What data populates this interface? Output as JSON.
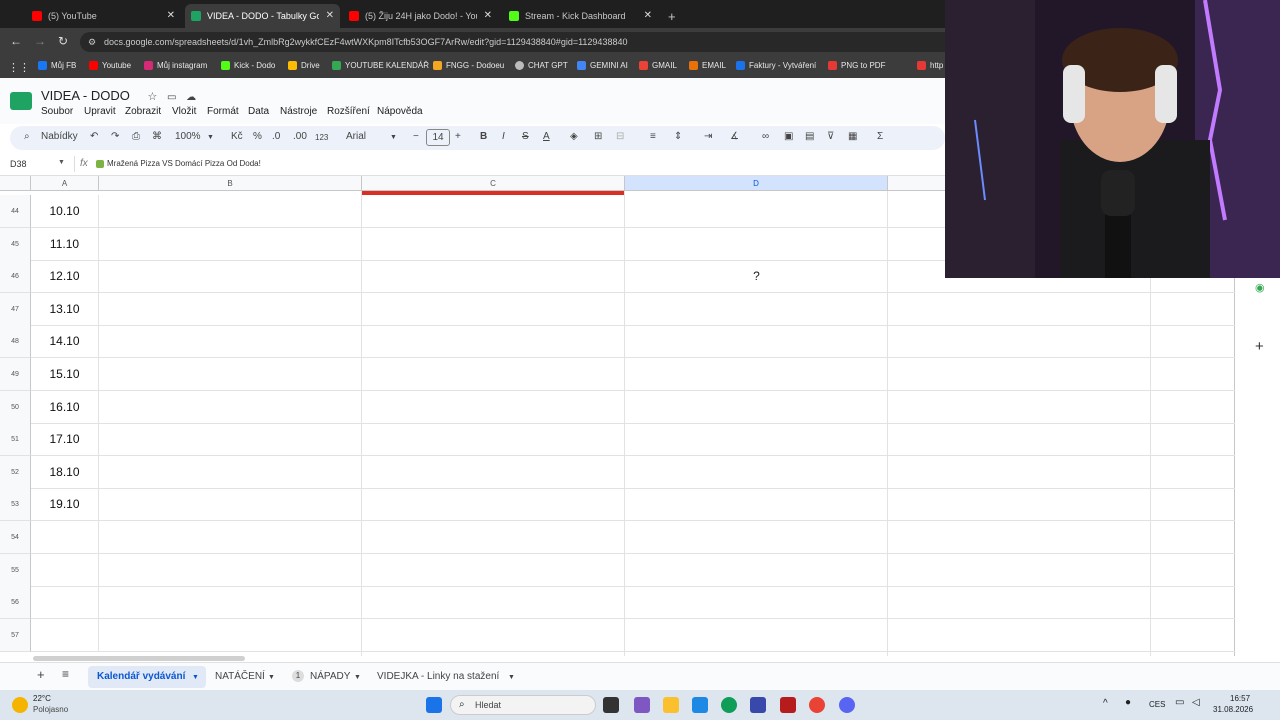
{
  "browser": {
    "tabs": [
      {
        "label": "(5) YouTube",
        "color": "#ff0000",
        "active": false
      },
      {
        "label": "VIDEA - DODO - Tabulky Googl",
        "color": "#1ea362",
        "active": true
      },
      {
        "label": "(5) Žiju 24H jako Dodo! - YouTu",
        "color": "#ff0000",
        "active": false
      },
      {
        "label": "Stream - Kick Dashboard",
        "color": "#53fc18",
        "active": false
      }
    ],
    "new_tab": "+",
    "url": "docs.google.com/spreadsheets/d/1vh_ZmlbRg2wykkfCEzF4wtWXKpm8ITcfb53OGF7ArRw/edit?gid=1129438840#gid=1129438840",
    "bookmarks": [
      "Můj FB",
      "Youtube",
      "Můj instagram",
      "Kick - Dodo",
      "Drive",
      "YOUTUBE KALENDÁŘ",
      "FNGG - Dodoeu",
      "CHAT GPT",
      "GEMINI AI",
      "GMAIL",
      "EMAIL",
      "Faktury - Vytváření",
      "PNG to PDF",
      "http"
    ]
  },
  "sheets": {
    "title": "VIDEA - DODO",
    "menu": [
      "Soubor",
      "Upravit",
      "Zobrazit",
      "Vložit",
      "Formát",
      "Data",
      "Nástroje",
      "Rozšíření",
      "Nápověda"
    ],
    "toolbar": {
      "search": "Nabídky",
      "zoom": "100%",
      "currency": "Kč",
      "percent": "%",
      "dec_less": ".0",
      "dec_more": ".00",
      "num_format": "123",
      "font": "Arial",
      "font_size": "14",
      "bold": "B",
      "italic": "I",
      "strike": "S",
      "text_color": "A",
      "sum": "Σ"
    },
    "name_box": "D38",
    "formula": "Mražená Pizza VS Domácí Pizza Od Doda!",
    "columns": [
      "A",
      "B",
      "C",
      "D"
    ],
    "rows": [
      {
        "num": "44",
        "a": "10.10",
        "d": ""
      },
      {
        "num": "45",
        "a": "11.10",
        "d": ""
      },
      {
        "num": "46",
        "a": "12.10",
        "d": "?"
      },
      {
        "num": "47",
        "a": "13.10",
        "d": ""
      },
      {
        "num": "48",
        "a": "14.10",
        "d": ""
      },
      {
        "num": "49",
        "a": "15.10",
        "d": ""
      },
      {
        "num": "50",
        "a": "16.10",
        "d": ""
      },
      {
        "num": "51",
        "a": "17.10",
        "d": ""
      },
      {
        "num": "52",
        "a": "18.10",
        "d": ""
      },
      {
        "num": "53",
        "a": "19.10",
        "d": ""
      },
      {
        "num": "54",
        "a": "",
        "d": ""
      },
      {
        "num": "55",
        "a": "",
        "d": ""
      },
      {
        "num": "56",
        "a": "",
        "d": ""
      },
      {
        "num": "57",
        "a": "",
        "d": ""
      }
    ],
    "sheet_tabs": [
      {
        "label": "Kalendář vydávání",
        "active": true
      },
      {
        "label": "NATÁČENÍ",
        "active": false
      },
      {
        "label": "NÁPADY",
        "badge": "1",
        "active": false
      },
      {
        "label": "VIDEJKA - Linky na stažení",
        "active": false
      }
    ]
  },
  "taskbar": {
    "weather_temp": "22°C",
    "weather_desc": "Polojasno",
    "search_placeholder": "Hledat",
    "lang": "CES",
    "time": "16:57",
    "date": "31.08.2026"
  }
}
